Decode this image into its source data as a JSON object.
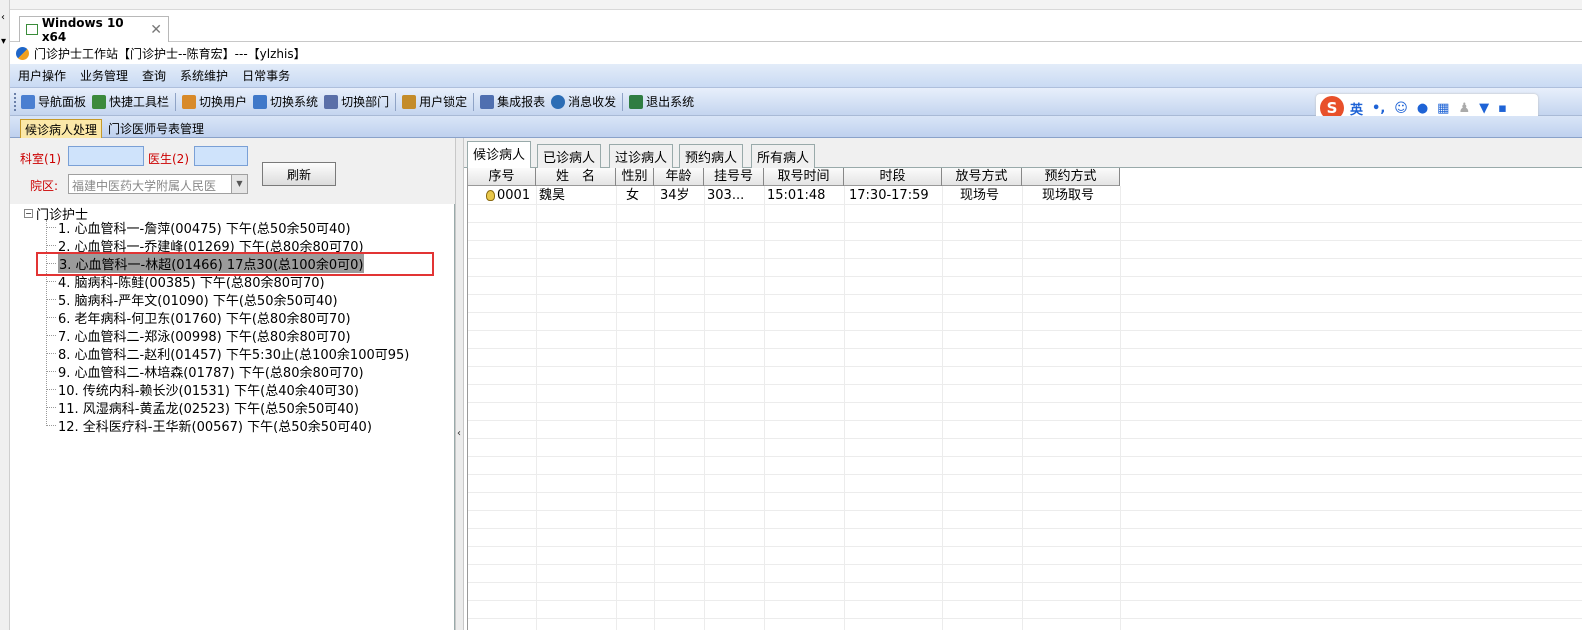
{
  "vm": {
    "tab_title": "Windows 10 x64",
    "close_glyph": "✕",
    "left_glyphs": [
      "‹",
      "▾"
    ]
  },
  "app": {
    "title": "门诊护士工作站【门诊护士--陈育宏】---【ylzhis】"
  },
  "menu": [
    "用户操作",
    "业务管理",
    "查询",
    "系统维护",
    "日常事务"
  ],
  "toolbar": [
    {
      "label": "导航面板",
      "icon": "navigation-panel-icon",
      "color": "#4a7fd1"
    },
    {
      "label": "快捷工具栏",
      "icon": "quick-toolbar-icon",
      "color": "#3c8a3c"
    },
    {
      "label": "切换用户",
      "icon": "switch-user-icon",
      "color": "#d88a2a"
    },
    {
      "label": "切换系统",
      "icon": "switch-system-icon",
      "color": "#3f78c9"
    },
    {
      "label": "切换部门",
      "icon": "switch-department-icon",
      "color": "#5a6fa8"
    },
    {
      "label": "用户锁定",
      "icon": "user-lock-icon",
      "color": "#c48c2a"
    },
    {
      "label": "集成报表",
      "icon": "report-icon",
      "color": "#4f6fb0"
    },
    {
      "label": "消息收发",
      "icon": "message-icon",
      "color": "#2c6db5"
    },
    {
      "label": "退出系统",
      "icon": "exit-icon",
      "color": "#2f7d42"
    }
  ],
  "ime": {
    "logo": "S",
    "mode": "英",
    "punct": "•,",
    "icons": [
      "emoji-icon",
      "microphone-icon",
      "keyboard-icon",
      "user-icon",
      "skin-icon",
      "apps-icon"
    ]
  },
  "main_tabs": [
    {
      "label": "候诊病人处理",
      "active": true
    },
    {
      "label": "门诊医师号表管理",
      "active": false
    }
  ],
  "filter": {
    "dept_label": "科室(1)",
    "doctor_label": "医生(2)",
    "campus_label": "院区:",
    "campus_value": "福建中医药大学附属人民医",
    "refresh_label": "刷新"
  },
  "tree": {
    "root": "门诊护士",
    "items": [
      "1. 心血管科一-詹萍(00475) 下午(总50余50可40)",
      "2. 心血管科一-乔建峰(01269) 下午(总80余80可70)",
      "3. 心血管科一-林超(01466) 17点30(总100余0可0)",
      "4. 脑病科-陈鲑(00385) 下午(总80余80可70)",
      "5. 脑病科-严年文(01090) 下午(总50余50可40)",
      "6. 老年病科-何卫东(01760) 下午(总80余80可70)",
      "7. 心血管科二-郑泳(00998) 下午(总80余80可70)",
      "8. 心血管科二-赵利(01457) 下午5:30止(总100余100可95)",
      "9. 心血管科二-林培森(01787) 下午(总80余80可70)",
      "10. 传统内科-赖长沙(01531) 下午(总40余40可30)",
      "11. 风湿病科-黄孟龙(02523) 下午(总50余50可40)",
      "12. 全科医疗科-王华新(00567) 下午(总50余50可40)"
    ],
    "selected_index": 2
  },
  "patient_tabs": [
    {
      "label": "候诊病人",
      "active": true
    },
    {
      "label": "已诊病人",
      "active": false
    },
    {
      "label": "过诊病人",
      "active": false
    },
    {
      "label": "预约病人",
      "active": false
    },
    {
      "label": "所有病人",
      "active": false
    }
  ],
  "grid": {
    "columns": [
      "序号",
      "姓　名",
      "性别",
      "年龄",
      "挂号号",
      "取号时间",
      "时段",
      "放号方式",
      "预约方式"
    ],
    "rows": [
      [
        "0001",
        "魏昊",
        "女",
        "34岁",
        "303...",
        "15:01:48",
        "17:30-17:59",
        "现场号",
        "现场取号"
      ]
    ]
  },
  "splitter_glyph": "‹"
}
